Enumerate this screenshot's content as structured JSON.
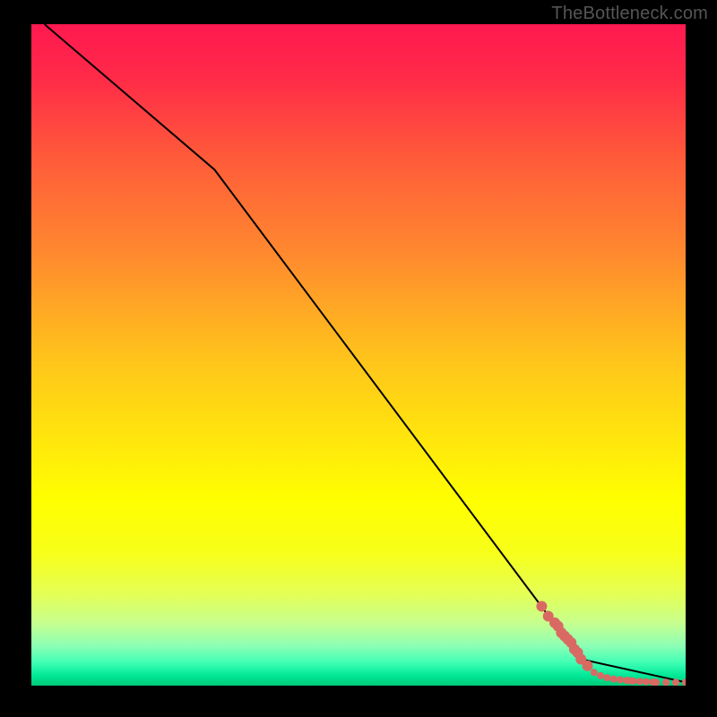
{
  "watermark": "TheBottleneck.com",
  "chart_data": {
    "type": "line",
    "title": "",
    "xlabel": "",
    "ylabel": "",
    "xlim": [
      0,
      100
    ],
    "ylim": [
      0,
      100
    ],
    "line": {
      "x": [
        2,
        28,
        84,
        100
      ],
      "y": [
        100,
        78,
        4,
        0.5
      ],
      "color": "#000000"
    },
    "markers": {
      "x": [
        78,
        79,
        80,
        80.5,
        81,
        81.5,
        82,
        82.5,
        83,
        83.5,
        84,
        85,
        86,
        87,
        88,
        89,
        90,
        91,
        91.5,
        92,
        93,
        94,
        95,
        95.5,
        97,
        98.5,
        100
      ],
      "y": [
        12,
        10.5,
        9.5,
        9,
        8,
        7.5,
        7,
        6.5,
        5.5,
        5,
        4,
        3,
        2,
        1.5,
        1.2,
        1,
        0.9,
        0.8,
        0.75,
        0.7,
        0.65,
        0.6,
        0.55,
        0.5,
        0.5,
        0.5,
        0.5
      ],
      "color": "#d86a63",
      "radius_base": 4,
      "radius_start": 6
    },
    "background": {
      "type": "vertical-gradient",
      "stops": [
        {
          "offset": 0.0,
          "color": "#ff1950"
        },
        {
          "offset": 0.08,
          "color": "#ff2a48"
        },
        {
          "offset": 0.2,
          "color": "#ff5a3a"
        },
        {
          "offset": 0.35,
          "color": "#ff8a2e"
        },
        {
          "offset": 0.5,
          "color": "#ffc21c"
        },
        {
          "offset": 0.62,
          "color": "#ffe40e"
        },
        {
          "offset": 0.72,
          "color": "#ffff00"
        },
        {
          "offset": 0.8,
          "color": "#f7ff1a"
        },
        {
          "offset": 0.86,
          "color": "#e5ff54"
        },
        {
          "offset": 0.905,
          "color": "#c7ff8e"
        },
        {
          "offset": 0.94,
          "color": "#8cffb5"
        },
        {
          "offset": 0.965,
          "color": "#40ffb5"
        },
        {
          "offset": 0.985,
          "color": "#00e896"
        },
        {
          "offset": 1.0,
          "color": "#00c878"
        }
      ]
    }
  }
}
